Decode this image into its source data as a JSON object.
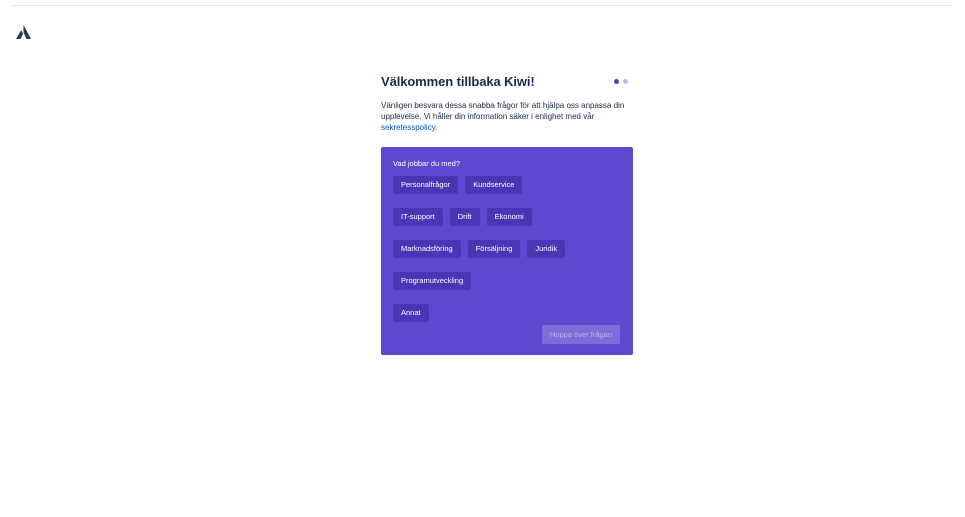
{
  "header": {
    "title": "Välkommen tillbaka Kiwi!",
    "progress": {
      "current_step": 1,
      "total_steps": 2
    }
  },
  "intro": {
    "text_before": "Vänligen besvara dessa snabba frågor för att hjälpa oss anpassa din upplevelse. Vi håller din information säker i enlighet med vår ",
    "link_label": "sekretesspolicy",
    "text_after": "."
  },
  "question": {
    "label": "Vad jobbar du med?",
    "options": [
      "Personalfrågor",
      "Kundservice",
      "IT-support",
      "Drift",
      "Ekonomi",
      "Marknadsföring",
      "Försäljning",
      "Juridik",
      "Programutveckling",
      "Annat"
    ],
    "skip_label": "Hoppa över frågan"
  },
  "colors": {
    "card_bg": "#5f47cf",
    "chip_bg": "#4c35b5",
    "link": "#0052cc",
    "logo": "#253858"
  }
}
